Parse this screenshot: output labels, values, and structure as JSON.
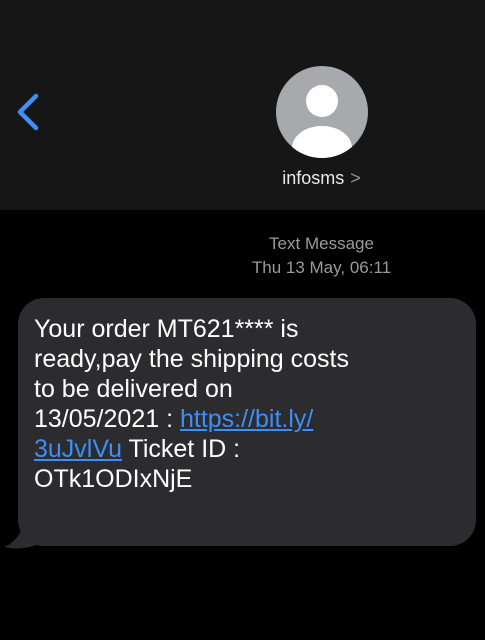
{
  "header": {
    "contact_name": "infosms",
    "contact_chevron": ">"
  },
  "thread": {
    "kind": "Text Message",
    "timestamp": "Thu 13 May, 06:11"
  },
  "message": {
    "line1": "Your order MT621**** is",
    "line2": "ready,pay the shipping costs",
    "line3": "to be delivered on",
    "line4_text": "13/05/2021 : ",
    "link_part1": "https://bit.ly/",
    "link_part2": "3uJvlVu",
    "line5_text": " Ticket ID :",
    "line6": "OTk1ODIxNjE"
  },
  "colors": {
    "background": "#000000",
    "header": "#161616",
    "bubble": "#2c2c2e",
    "link": "#3e8ef7",
    "back_arrow": "#3f8ef5",
    "avatar": "#a8a9ad"
  },
  "icons": {
    "back": "chevron-left-icon",
    "avatar": "person-icon"
  }
}
